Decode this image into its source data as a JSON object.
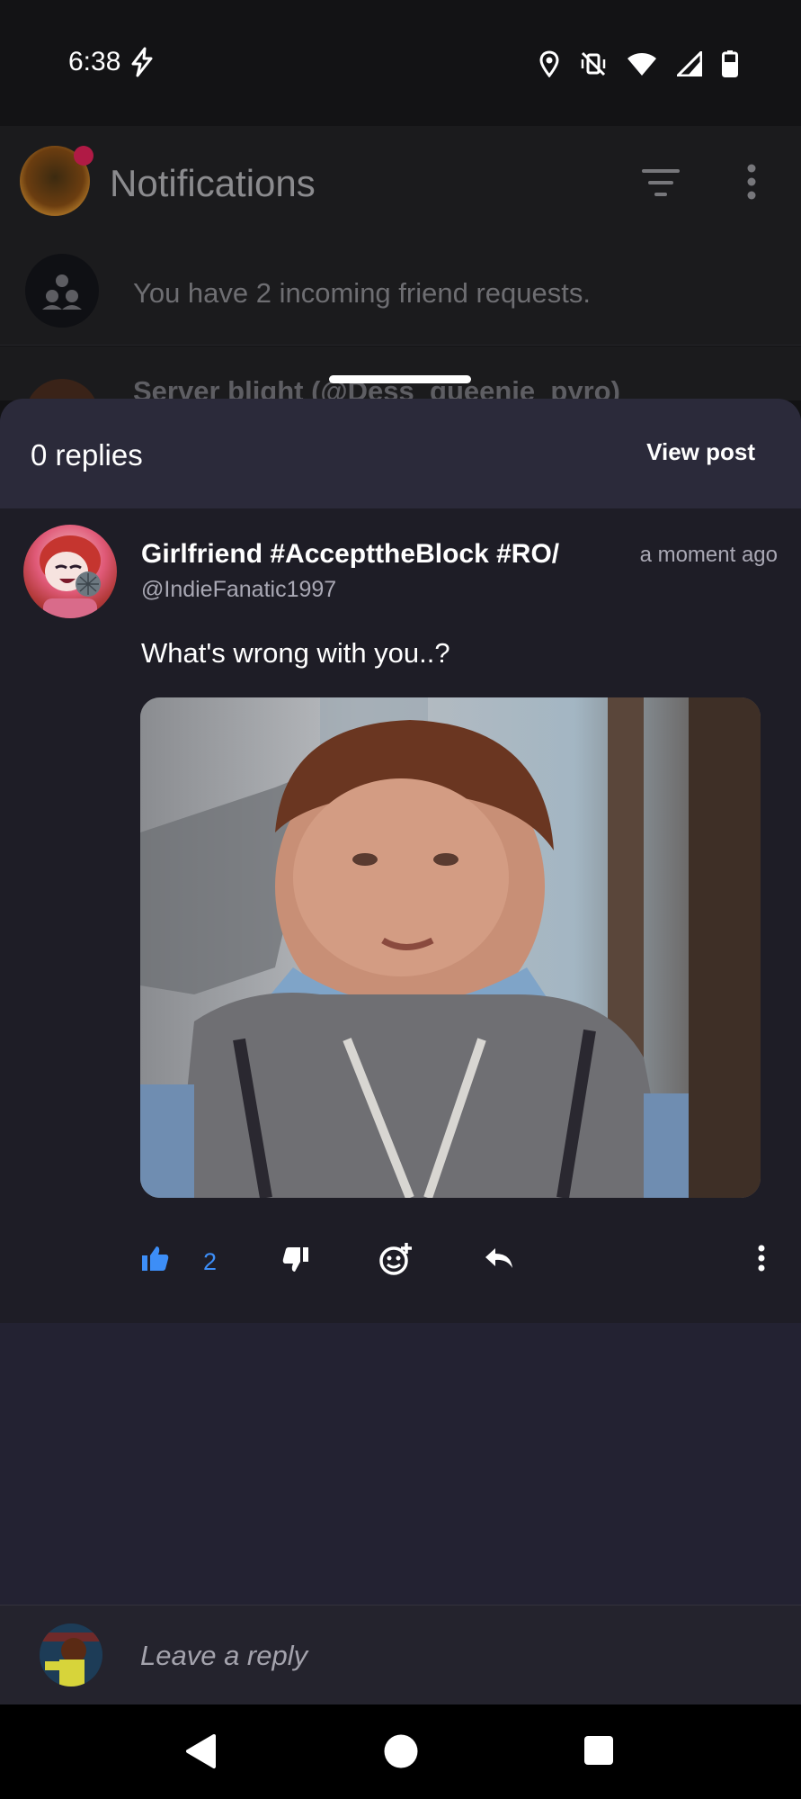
{
  "status_bar": {
    "time": "6:38",
    "icons": [
      "charging-bolt-icon",
      "location-icon",
      "vibrate-off-icon",
      "wifi-icon",
      "signal-icon",
      "battery-icon"
    ]
  },
  "background": {
    "title": "Notifications",
    "friend_requests_text": "You have 2 incoming friend requests.",
    "server_row_text": "Server blight (@Dess_queenie_pyro)"
  },
  "sheet": {
    "replies_label": "0 replies",
    "view_post_label": "View post"
  },
  "post": {
    "author": "Girlfriend #AccepttheBlock #RO/",
    "handle": "@IndieFanatic1997",
    "time": "a moment ago",
    "body": "What's wrong with you..?",
    "like_count": "2"
  },
  "reply": {
    "placeholder": "Leave a reply"
  },
  "colors": {
    "sheet_bg": "#232232",
    "post_bg": "#1e1d26",
    "accent_blue": "#3d8ef7",
    "notification_dot": "#b01a45"
  }
}
